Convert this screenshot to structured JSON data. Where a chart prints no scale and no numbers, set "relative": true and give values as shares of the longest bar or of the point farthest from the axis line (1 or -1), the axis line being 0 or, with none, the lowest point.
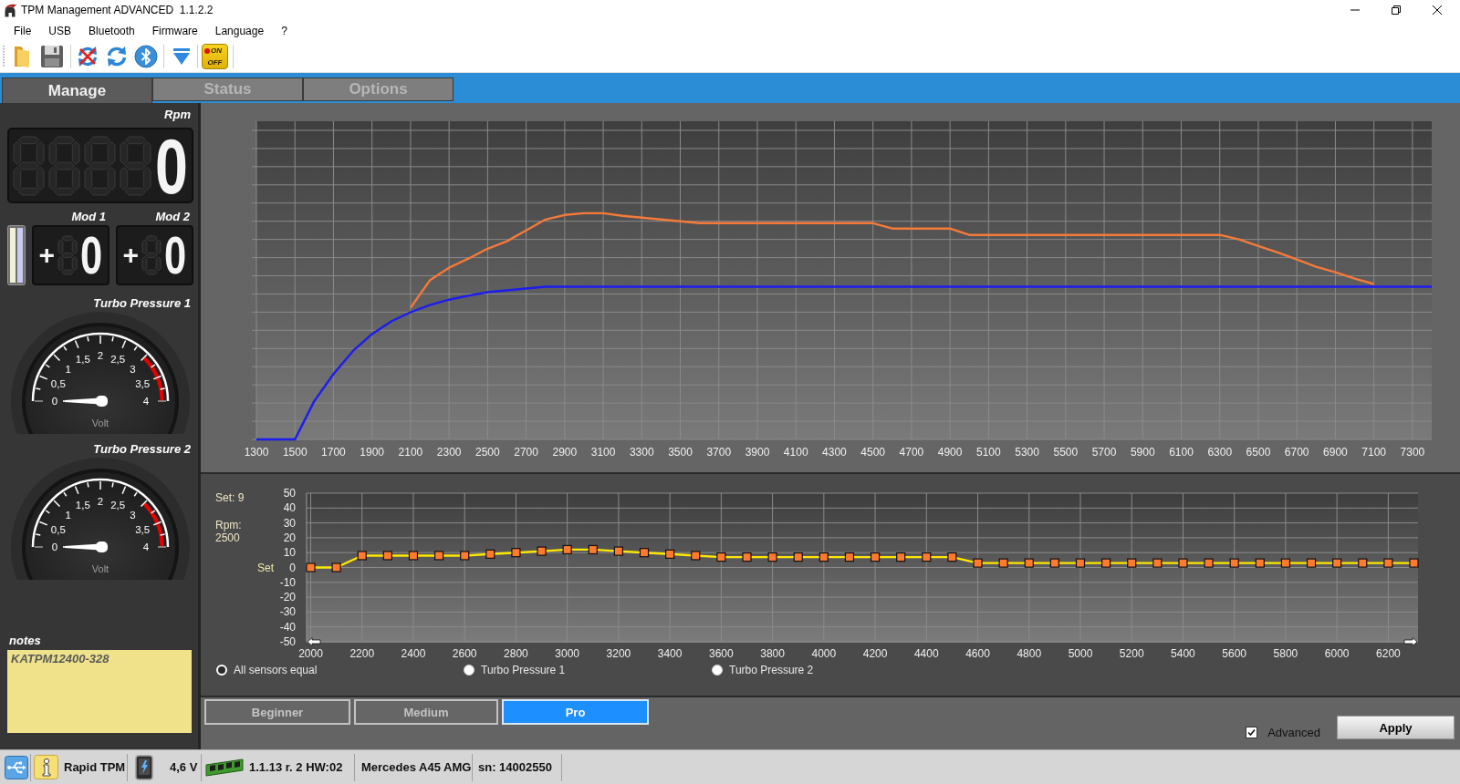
{
  "window": {
    "title": "TPM Management ADVANCED  1.1.2.2"
  },
  "menu": [
    "File",
    "USB",
    "Bluetooth",
    "Firmware",
    "Language",
    "?"
  ],
  "toolbar": {
    "power_switch": {
      "on_text": "ON",
      "off_text": "OFF"
    }
  },
  "tabs": [
    {
      "label": "Manage",
      "selected": true
    },
    {
      "label": "Status",
      "selected": false
    },
    {
      "label": "Options",
      "selected": false
    }
  ],
  "sidebar": {
    "rpm": {
      "label": "Rpm",
      "value": "0"
    },
    "mods": [
      {
        "label": "Mod 1",
        "sign": "+",
        "value": "0"
      },
      {
        "label": "Mod 2",
        "sign": "+",
        "value": "0"
      }
    ],
    "gauges": [
      {
        "title": "Turbo Pressure 1",
        "unit": "Volt",
        "scale": [
          "0",
          "0,5",
          "1",
          "1,5",
          "2",
          "2,5",
          "3",
          "3,5",
          "4"
        ],
        "level": 0
      },
      {
        "title": "Turbo Pressure 2",
        "unit": "Volt",
        "scale": [
          "0",
          "0,5",
          "1",
          "1,5",
          "2",
          "2,5",
          "3",
          "3,5",
          "4"
        ],
        "level": 0
      }
    ],
    "notes": {
      "label": "notes",
      "value": "KATPM12400-328"
    }
  },
  "upper_chart": {
    "chart_data": {
      "type": "line",
      "relative": true,
      "grid": true,
      "x": [
        1300,
        1500,
        1600,
        1700,
        1800,
        1900,
        2000,
        2100,
        2200,
        2300,
        2400,
        2500,
        2600,
        2700,
        2800,
        2900,
        3000,
        3100,
        3200,
        3300,
        3400,
        3500,
        3600,
        4500,
        4600,
        4900,
        5000,
        6300,
        6400,
        6500,
        6600,
        6700,
        6800,
        6900,
        7000,
        7100,
        7200,
        7300,
        7400
      ],
      "series": [
        {
          "color": "#f47a3a",
          "values": [
            null,
            null,
            null,
            null,
            null,
            null,
            null,
            0.582,
            0.703,
            0.759,
            0.799,
            0.843,
            0.876,
            0.924,
            0.972,
            0.992,
            1,
            1,
            0.988,
            0.98,
            0.972,
            0.964,
            0.956,
            0.956,
            0.932,
            0.932,
            0.904,
            0.904,
            0.884,
            0.855,
            0.827,
            0.795,
            0.763,
            0.739,
            0.711,
            0.687,
            null,
            null,
            null
          ]
        },
        {
          "color": "#1c1cf0",
          "values": [
            0,
            0,
            0.169,
            0.289,
            0.39,
            0.466,
            0.522,
            0.562,
            0.594,
            0.618,
            0.635,
            0.651,
            0.659,
            0.667,
            0.675,
            0.675,
            0.675,
            0.675,
            0.675,
            0.675,
            0.675,
            0.675,
            0.675,
            0.675,
            0.675,
            0.675,
            0.675,
            0.675,
            0.675,
            0.675,
            0.675,
            0.675,
            0.675,
            0.675,
            0.675,
            0.675,
            0.675,
            0.675,
            0.675
          ]
        }
      ],
      "xlim": [
        1300,
        7400
      ],
      "xticks": [
        1300,
        1500,
        1700,
        1900,
        2100,
        2300,
        2500,
        2700,
        2900,
        3100,
        3300,
        3500,
        3700,
        3900,
        4100,
        4300,
        4500,
        4700,
        4900,
        5100,
        5300,
        5500,
        5700,
        5900,
        6100,
        6300,
        6500,
        6700,
        6900,
        7100,
        7300
      ]
    }
  },
  "lower_chart": {
    "set_reading": "Set: 9",
    "rpm_label": "Rpm:",
    "rpm_value": "2500",
    "chart_data": {
      "type": "line",
      "grid": true,
      "ylabel": "Set",
      "x": [
        2000,
        2100,
        2200,
        2300,
        2400,
        2500,
        2600,
        2700,
        2800,
        2900,
        3000,
        3100,
        3200,
        3300,
        3400,
        3500,
        3600,
        3700,
        3800,
        3900,
        4000,
        4100,
        4200,
        4300,
        4400,
        4500,
        4600,
        4700,
        4800,
        4900,
        5000,
        5100,
        5200,
        5300,
        5400,
        5500,
        5600,
        5700,
        5800,
        5900,
        6000,
        6100,
        6200,
        6300
      ],
      "series": [
        {
          "color": "#ffe800",
          "marker": "square",
          "values": [
            0,
            0,
            8,
            8,
            8,
            8,
            8,
            9,
            10,
            11,
            12,
            12,
            11,
            10,
            9,
            8,
            7,
            7,
            7,
            7,
            7,
            7,
            7,
            7,
            7,
            7,
            3,
            3,
            3,
            3,
            3,
            3,
            3,
            3,
            3,
            3,
            3,
            3,
            3,
            3,
            3,
            3,
            3,
            3
          ]
        }
      ],
      "xlim": [
        2000,
        6300
      ],
      "ylim": [
        -50,
        50
      ],
      "xticks": [
        2000,
        2200,
        2400,
        2600,
        2800,
        3000,
        3200,
        3400,
        3600,
        3800,
        4000,
        4200,
        4400,
        4600,
        4800,
        5000,
        5200,
        5400,
        5600,
        5800,
        6000,
        6200
      ],
      "yticks": [
        -50,
        -40,
        -30,
        -20,
        -10,
        0,
        10,
        20,
        30,
        40,
        50
      ]
    }
  },
  "sensor_options": [
    {
      "label": "All sensors equal",
      "selected": true
    },
    {
      "label": "Turbo Pressure 1",
      "selected": false
    },
    {
      "label": "Turbo Pressure 2",
      "selected": false
    }
  ],
  "modes": [
    {
      "label": "Beginner",
      "selected": false
    },
    {
      "label": "Medium",
      "selected": false
    },
    {
      "label": "Pro",
      "selected": true
    }
  ],
  "advanced": {
    "label": "Advanced",
    "checked": true
  },
  "apply_button": "Apply",
  "status_bar": {
    "device": "Rapid TPM",
    "voltage": "4,6 V",
    "firmware": "1.1.13 r. 2 HW:02",
    "vehicle": "Mercedes A45 AMG",
    "serial": "sn: 14002550"
  }
}
